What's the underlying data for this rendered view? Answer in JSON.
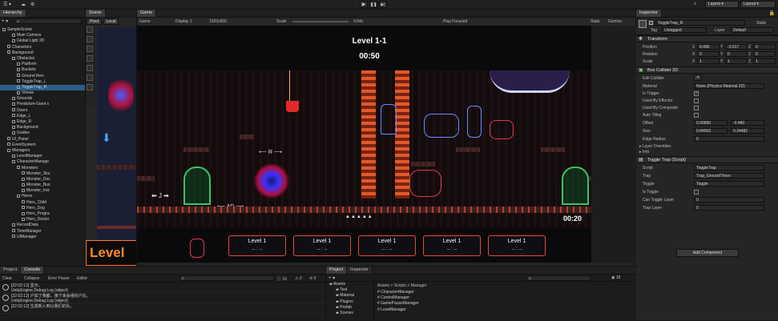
{
  "toolbar": {
    "layers": "Layers",
    "layout": "Layout"
  },
  "hierarchy": {
    "tab": "Hierarchy",
    "items": [
      {
        "label": "SampleScene",
        "indent": 0,
        "sel": false
      },
      {
        "label": "Main Camera",
        "indent": 2,
        "sel": false
      },
      {
        "label": "Global Light 2D",
        "indent": 2,
        "sel": false
      },
      {
        "label": "Characters",
        "indent": 1,
        "sel": false
      },
      {
        "label": "Background",
        "indent": 1,
        "sel": false
      },
      {
        "label": "Obstacles",
        "indent": 2,
        "sel": false
      },
      {
        "label": "Platform",
        "indent": 3,
        "sel": false
      },
      {
        "label": "Buckets",
        "indent": 3,
        "sel": false
      },
      {
        "label": "Ground then",
        "indent": 3,
        "sel": false
      },
      {
        "label": "ToggleTrap_L",
        "indent": 3,
        "sel": false
      },
      {
        "label": "ToggleTrap_R",
        "indent": 3,
        "sel": true
      },
      {
        "label": "Vinese",
        "indent": 3,
        "sel": false
      },
      {
        "label": "Grounds",
        "indent": 2,
        "sel": false
      },
      {
        "label": "Pendulum-Giant s",
        "indent": 2,
        "sel": false
      },
      {
        "label": "Doors",
        "indent": 2,
        "sel": false
      },
      {
        "label": "Edge_L",
        "indent": 2,
        "sel": false
      },
      {
        "label": "Edge_R",
        "indent": 2,
        "sel": false
      },
      {
        "label": "Background",
        "indent": 2,
        "sel": false
      },
      {
        "label": "Guides",
        "indent": 2,
        "sel": false
      },
      {
        "label": "UI_Panel",
        "indent": 1,
        "sel": false
      },
      {
        "label": "EventSystem",
        "indent": 1,
        "sel": false
      },
      {
        "label": "Managers",
        "indent": 1,
        "sel": false
      },
      {
        "label": "LevelManager",
        "indent": 2,
        "sel": false
      },
      {
        "label": "CharacterManage",
        "indent": 2,
        "sel": false
      },
      {
        "label": "Monsters",
        "indent": 3,
        "sel": false
      },
      {
        "label": "Monster_Sku",
        "indent": 4,
        "sel": false
      },
      {
        "label": "Monster_Doc",
        "indent": 4,
        "sel": false
      },
      {
        "label": "Monster_Bus",
        "indent": 4,
        "sel": false
      },
      {
        "label": "Monster_Inw",
        "indent": 4,
        "sel": false
      },
      {
        "label": "Heros",
        "indent": 3,
        "sel": false
      },
      {
        "label": "Hero_Child",
        "indent": 4,
        "sel": false
      },
      {
        "label": "Hero_Dog",
        "indent": 4,
        "sel": false
      },
      {
        "label": "Hero_Progra",
        "indent": 4,
        "sel": false
      },
      {
        "label": "Hero_Doctor",
        "indent": 4,
        "sel": false
      },
      {
        "label": "RecordData",
        "indent": 2,
        "sel": false
      },
      {
        "label": "TimeManager",
        "indent": 2,
        "sel": false
      },
      {
        "label": "UIManager",
        "indent": 2,
        "sel": false
      }
    ]
  },
  "scene": {
    "tab": "Scene",
    "pivot": "Pivot",
    "local": "Local",
    "level_text": "Level"
  },
  "game": {
    "tab": "Game",
    "view_mode": "Game",
    "display": "Display 1",
    "resolution": "1920x900",
    "scale_label": "Scale",
    "scale_value": "0.64x",
    "play_focused": "Play Focused",
    "stats": "Stats",
    "gizmos": "Gizmos",
    "hud_level": "Level 1-1",
    "hud_time": "00:50",
    "hud_timer_small": "00:20",
    "hint_j": "J",
    "hint_ad": "AD",
    "hint_r": "R",
    "level_cards": [
      {
        "title": "Level 1",
        "sub": "-- : --"
      },
      {
        "title": "Level 1",
        "sub": "-- : --"
      },
      {
        "title": "Level 1",
        "sub": "-- : --"
      },
      {
        "title": "Level 1",
        "sub": "-- : --"
      },
      {
        "title": "Level 1",
        "sub": "-- : --"
      }
    ]
  },
  "inspector": {
    "tab": "Inspector",
    "object_name": "ToggleTrap_R",
    "static": "Static",
    "tag_label": "Tag",
    "tag_value": "Untagged",
    "layer_label": "Layer",
    "layer_value": "Default",
    "transform": {
      "title": "Transform",
      "rows": [
        {
          "label": "Position",
          "x": "8.486",
          "y": "-3.517",
          "z": "0"
        },
        {
          "label": "Rotation",
          "x": "0",
          "y": "0",
          "z": "0"
        },
        {
          "label": "Scale",
          "x": "1",
          "y": "1",
          "z": "1"
        }
      ]
    },
    "box_collider": {
      "title": "Box Collider 2D",
      "edit_label": "Edit Collider",
      "rows": [
        {
          "label": "Material",
          "value": "None (Physics Material 2D)"
        },
        {
          "label": "Is Trigger",
          "value": "✓"
        },
        {
          "label": "Used By Effector",
          "value": ""
        },
        {
          "label": "Used By Composite",
          "value": ""
        },
        {
          "label": "Auto Tiling",
          "value": ""
        }
      ],
      "offset_label": "Offset",
      "offset_x": "0.06899",
      "offset_y": "-0.480",
      "size_label": "Size",
      "size_x": "0.84553",
      "size_y": "0.34482",
      "edge_label": "Edge Radius",
      "edge_value": "0",
      "layer_overrides": "Layer Overrides",
      "info": "Info"
    },
    "toggle_trap": {
      "title": "Toggle Trap (Script)",
      "rows": [
        {
          "label": "Script",
          "value": "ToggleTrap"
        },
        {
          "label": "Trap",
          "value": "Trap_GroundThorn"
        },
        {
          "label": "Toggle",
          "value": "Toggle"
        },
        {
          "label": "Is Toggle",
          "value": ""
        },
        {
          "label": "Can Toggle Layer",
          "value": "0"
        },
        {
          "label": "Trap Layer",
          "value": "0"
        }
      ]
    },
    "add_component": "Add Component"
  },
  "console": {
    "tab_project": "Project",
    "tab_console": "Console",
    "clear": "Clear",
    "collapse": "Collapse",
    "error_pause": "Error Pause",
    "editor": "Editor",
    "count_1": "16",
    "count_2": "0",
    "count_3": "0",
    "rows": [
      {
        "time": "[22:02:12]",
        "msg": "显示。",
        "sub": "UnityEngine.Debug:Log (object)"
      },
      {
        "time": "[22:02:12]",
        "msg": "户如了我都。接下来会组织户比。",
        "sub": "UnityEngine.Debug:Log (object)"
      },
      {
        "time": "[22:02:12]",
        "msg": "生成新入到以我们的队。",
        "sub": ""
      }
    ]
  },
  "project": {
    "tab_project": "Project",
    "tab_inspector": "Inspector",
    "breadcrumb": "Assets > Scripts > Manager",
    "tree": [
      "Assets",
      "Test",
      "Material",
      "Plugins",
      "Prefab",
      "Scenes"
    ],
    "files": [
      "CharacterManager",
      "ControlManager",
      "GamePauseManager",
      "LevelManager"
    ],
    "count": "18"
  }
}
